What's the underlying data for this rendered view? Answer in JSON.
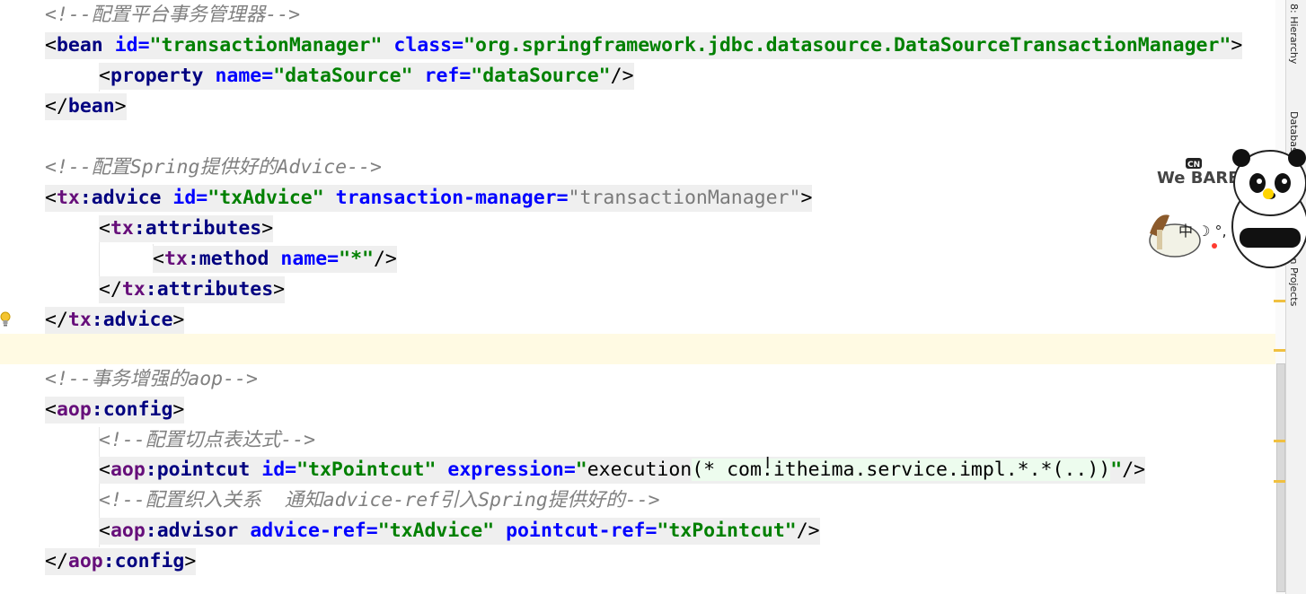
{
  "lines": [
    {
      "id": "c1",
      "segments": [
        {
          "cls": "cm",
          "text": "<!--配置平台事务管理器-->"
        }
      ]
    },
    {
      "id": "b1",
      "segments": [
        {
          "cls": "pc",
          "text": "<"
        },
        {
          "cls": "tn",
          "text": "bean"
        },
        {
          "cls": "pc",
          "text": " "
        },
        {
          "cls": "an",
          "text": "id="
        },
        {
          "cls": "av",
          "text": "\"transactionManager\""
        },
        {
          "cls": "pc",
          "text": " "
        },
        {
          "cls": "an",
          "text": "class="
        },
        {
          "cls": "av",
          "text": "\"org.springframework.jdbc.datasource.DataSourceTransactionManager\""
        },
        {
          "cls": "pc",
          "text": ">"
        }
      ]
    },
    {
      "id": "b2",
      "segments": [
        {
          "cls": "pc",
          "text": "<"
        },
        {
          "cls": "tn",
          "text": "property"
        },
        {
          "cls": "pc",
          "text": " "
        },
        {
          "cls": "an",
          "text": "name="
        },
        {
          "cls": "av",
          "text": "\"dataSource\""
        },
        {
          "cls": "pc",
          "text": " "
        },
        {
          "cls": "an",
          "text": "ref="
        },
        {
          "cls": "av",
          "text": "\"dataSource\""
        },
        {
          "cls": "pc",
          "text": "/>"
        }
      ]
    },
    {
      "id": "b3",
      "segments": [
        {
          "cls": "pc",
          "text": "</"
        },
        {
          "cls": "tn",
          "text": "bean"
        },
        {
          "cls": "pc",
          "text": ">"
        }
      ]
    },
    {
      "id": "c2",
      "segments": [
        {
          "cls": "cm",
          "text": "<!--配置Spring提供好的Advice-->"
        }
      ]
    },
    {
      "id": "t1",
      "segments": [
        {
          "cls": "pc",
          "text": "<"
        },
        {
          "cls": "ns",
          "text": "tx"
        },
        {
          "cls": "tn",
          "text": ":advice"
        },
        {
          "cls": "pc",
          "text": " "
        },
        {
          "cls": "an",
          "text": "id="
        },
        {
          "cls": "av",
          "text": "\"txAdvice\""
        },
        {
          "cls": "pc",
          "text": " "
        },
        {
          "cls": "an",
          "text": "transaction-manager="
        },
        {
          "cls": "av-dim",
          "text": "\"transactionManager\""
        },
        {
          "cls": "pc",
          "text": ">"
        }
      ]
    },
    {
      "id": "t2",
      "segments": [
        {
          "cls": "pc",
          "text": "<"
        },
        {
          "cls": "ns",
          "text": "tx"
        },
        {
          "cls": "tn",
          "text": ":attributes"
        },
        {
          "cls": "pc",
          "text": ">"
        }
      ]
    },
    {
      "id": "t3",
      "segments": [
        {
          "cls": "pc",
          "text": "<"
        },
        {
          "cls": "ns",
          "text": "tx"
        },
        {
          "cls": "tn",
          "text": ":method"
        },
        {
          "cls": "pc",
          "text": " "
        },
        {
          "cls": "an",
          "text": "name="
        },
        {
          "cls": "av",
          "text": "\"*\""
        },
        {
          "cls": "pc",
          "text": "/>"
        }
      ]
    },
    {
      "id": "t4",
      "segments": [
        {
          "cls": "pc",
          "text": "</"
        },
        {
          "cls": "ns",
          "text": "tx"
        },
        {
          "cls": "tn",
          "text": ":attributes"
        },
        {
          "cls": "pc",
          "text": ">"
        }
      ]
    },
    {
      "id": "t5",
      "segments": [
        {
          "cls": "pc",
          "text": "</"
        },
        {
          "cls": "ns",
          "text": "tx"
        },
        {
          "cls": "tn",
          "text": ":advice"
        },
        {
          "cls": "pc",
          "text": ">"
        }
      ]
    },
    {
      "id": "empty",
      "segments": []
    },
    {
      "id": "c3",
      "segments": [
        {
          "cls": "cm",
          "text": "<!--事务增强的aop-->"
        }
      ]
    },
    {
      "id": "a1",
      "segments": [
        {
          "cls": "pc",
          "text": "<"
        },
        {
          "cls": "ns",
          "text": "aop"
        },
        {
          "cls": "tn",
          "text": ":config"
        },
        {
          "cls": "pc",
          "text": ">"
        }
      ]
    },
    {
      "id": "c4",
      "segments": [
        {
          "cls": "cm",
          "text": "<!--配置切点表达式-->"
        }
      ]
    },
    {
      "id": "a2",
      "segments": [
        {
          "cls": "pc",
          "text": "<"
        },
        {
          "cls": "ns",
          "text": "aop"
        },
        {
          "cls": "tn",
          "text": ":pointcut"
        },
        {
          "cls": "pc",
          "text": " "
        },
        {
          "cls": "an",
          "text": "id="
        },
        {
          "cls": "av",
          "text": "\"txPointcut\""
        },
        {
          "cls": "pc",
          "text": " "
        },
        {
          "cls": "an",
          "text": "expression="
        },
        {
          "cls": "av",
          "text": "\""
        },
        {
          "cls": "pc",
          "text": "execution"
        },
        {
          "cls": "expr",
          "text": "(* com.itheima.service.impl.*.*(..))"
        },
        {
          "cls": "av",
          "text": "\""
        },
        {
          "cls": "pc",
          "text": "/>"
        }
      ]
    },
    {
      "id": "c5",
      "segments": [
        {
          "cls": "cm",
          "text": "<!--配置织入关系  通知advice-ref引入Spring提供好的-->"
        }
      ]
    },
    {
      "id": "a3",
      "segments": [
        {
          "cls": "pc",
          "text": "<"
        },
        {
          "cls": "ns",
          "text": "aop"
        },
        {
          "cls": "tn",
          "text": ":advisor"
        },
        {
          "cls": "pc",
          "text": " "
        },
        {
          "cls": "an",
          "text": "advice-ref="
        },
        {
          "cls": "av",
          "text": "\"txAdvice\""
        },
        {
          "cls": "pc",
          "text": " "
        },
        {
          "cls": "an",
          "text": "pointcut-ref="
        },
        {
          "cls": "av",
          "text": "\"txPointcut\""
        },
        {
          "cls": "pc",
          "text": "/>"
        }
      ]
    },
    {
      "id": "a4",
      "segments": [
        {
          "cls": "pc",
          "text": "</"
        },
        {
          "cls": "ns",
          "text": "aop"
        },
        {
          "cls": "tn",
          "text": ":config"
        },
        {
          "cls": "pc",
          "text": ">"
        }
      ]
    }
  ],
  "side_tabs": {
    "hierarchy": "8: Hierarchy",
    "database": "Database",
    "maven": "Maven Projects"
  },
  "sticker": {
    "brand": "We BARE BEARS",
    "badge": "CN",
    "ime_status": "中 ☽ °, ↑"
  },
  "colors": {
    "tag": "#000080",
    "namespace": "#660e7a",
    "attr_name": "#0000ff",
    "attr_value": "#008000",
    "comment": "#808080"
  }
}
